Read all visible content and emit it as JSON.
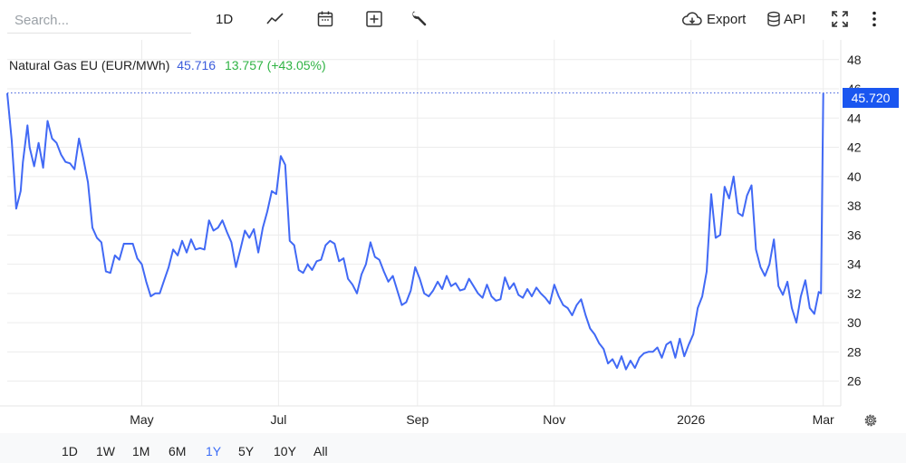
{
  "toolbar": {
    "search_placeholder": "Search...",
    "interval_label": "1D",
    "export_label": "Export",
    "api_label": "API",
    "icons": [
      "line-chart-icon",
      "calendar-icon",
      "add-box-icon",
      "wrench-icon",
      "cloud-download-icon",
      "database-icon",
      "fullscreen-icon",
      "more-vertical-icon"
    ]
  },
  "legend": {
    "name": "Natural Gas EU (EUR/MWh)",
    "value": "45.716",
    "change": "13.757 (+43.05%)"
  },
  "price_tag": "45.720",
  "range_buttons": [
    "1D",
    "1W",
    "1M",
    "6M",
    "1Y",
    "5Y",
    "10Y",
    "All"
  ],
  "active_range": "1Y",
  "colors": {
    "line": "#4169f5",
    "accent": "#1a56f0",
    "positive": "#2fb344",
    "grid": "#ececec"
  },
  "chart_data": {
    "type": "line",
    "title": "Natural Gas EU (EUR/MWh)",
    "xlabel": "",
    "ylabel": "",
    "x_tick_labels": [
      "May",
      "Jul",
      "Sep",
      "Nov",
      "2026",
      "Mar"
    ],
    "x_ticks": [
      "2025-05-01",
      "2025-07-01",
      "2025-09-01",
      "2025-11-01",
      "2026-01-01",
      "2026-03-01"
    ],
    "xlim": [
      "2025-03-02",
      "2026-03-08"
    ],
    "y_ticks": [
      26,
      28,
      30,
      32,
      34,
      36,
      38,
      40,
      42,
      44,
      46,
      48
    ],
    "ylim": [
      24.3,
      49.6
    ],
    "last_price_line": 45.72,
    "grid": true,
    "series": [
      {
        "points": [
          [
            "2025-03-02",
            45.7
          ],
          [
            "2025-03-04",
            42.5
          ],
          [
            "2025-03-05",
            40.2
          ],
          [
            "2025-03-06",
            37.8
          ],
          [
            "2025-03-08",
            39.0
          ],
          [
            "2025-03-09",
            41.0
          ],
          [
            "2025-03-11",
            43.5
          ],
          [
            "2025-03-12",
            42.0
          ],
          [
            "2025-03-14",
            40.7
          ],
          [
            "2025-03-16",
            42.3
          ],
          [
            "2025-03-18",
            40.6
          ],
          [
            "2025-03-20",
            43.8
          ],
          [
            "2025-03-22",
            42.6
          ],
          [
            "2025-03-24",
            42.3
          ],
          [
            "2025-03-26",
            41.5
          ],
          [
            "2025-03-28",
            41.0
          ],
          [
            "2025-03-30",
            40.9
          ],
          [
            "2025-04-01",
            40.5
          ],
          [
            "2025-04-03",
            42.6
          ],
          [
            "2025-04-05",
            41.2
          ],
          [
            "2025-04-07",
            39.6
          ],
          [
            "2025-04-09",
            36.5
          ],
          [
            "2025-04-11",
            35.8
          ],
          [
            "2025-04-13",
            35.5
          ],
          [
            "2025-04-15",
            33.5
          ],
          [
            "2025-04-17",
            33.4
          ],
          [
            "2025-04-19",
            34.6
          ],
          [
            "2025-04-21",
            34.3
          ],
          [
            "2025-04-23",
            35.4
          ],
          [
            "2025-04-25",
            35.4
          ],
          [
            "2025-04-27",
            35.4
          ],
          [
            "2025-04-29",
            34.4
          ],
          [
            "2025-05-01",
            34.0
          ],
          [
            "2025-05-03",
            32.8
          ],
          [
            "2025-05-05",
            31.8
          ],
          [
            "2025-05-07",
            32.0
          ],
          [
            "2025-05-09",
            32.0
          ],
          [
            "2025-05-11",
            32.9
          ],
          [
            "2025-05-13",
            33.8
          ],
          [
            "2025-05-15",
            35.0
          ],
          [
            "2025-05-17",
            34.6
          ],
          [
            "2025-05-19",
            35.6
          ],
          [
            "2025-05-21",
            34.8
          ],
          [
            "2025-05-23",
            35.7
          ],
          [
            "2025-05-25",
            35.0
          ],
          [
            "2025-05-27",
            35.1
          ],
          [
            "2025-05-29",
            35.0
          ],
          [
            "2025-05-31",
            37.0
          ],
          [
            "2025-06-02",
            36.3
          ],
          [
            "2025-06-04",
            36.5
          ],
          [
            "2025-06-06",
            37.0
          ],
          [
            "2025-06-08",
            36.2
          ],
          [
            "2025-06-10",
            35.5
          ],
          [
            "2025-06-12",
            33.8
          ],
          [
            "2025-06-14",
            35.0
          ],
          [
            "2025-06-16",
            36.3
          ],
          [
            "2025-06-18",
            35.8
          ],
          [
            "2025-06-20",
            36.4
          ],
          [
            "2025-06-22",
            34.8
          ],
          [
            "2025-06-24",
            36.5
          ],
          [
            "2025-06-26",
            37.6
          ],
          [
            "2025-06-28",
            39.0
          ],
          [
            "2025-06-30",
            38.8
          ],
          [
            "2025-07-02",
            41.4
          ],
          [
            "2025-07-04",
            40.8
          ],
          [
            "2025-07-06",
            35.6
          ],
          [
            "2025-07-08",
            35.3
          ],
          [
            "2025-07-10",
            33.6
          ],
          [
            "2025-07-12",
            33.4
          ],
          [
            "2025-07-14",
            34.0
          ],
          [
            "2025-07-16",
            33.6
          ],
          [
            "2025-07-18",
            34.2
          ],
          [
            "2025-07-20",
            34.3
          ],
          [
            "2025-07-22",
            35.3
          ],
          [
            "2025-07-24",
            35.6
          ],
          [
            "2025-07-26",
            35.4
          ],
          [
            "2025-07-28",
            34.2
          ],
          [
            "2025-07-30",
            34.4
          ],
          [
            "2025-08-01",
            33.0
          ],
          [
            "2025-08-03",
            32.6
          ],
          [
            "2025-08-05",
            32.0
          ],
          [
            "2025-08-07",
            33.3
          ],
          [
            "2025-08-09",
            34.0
          ],
          [
            "2025-08-11",
            35.5
          ],
          [
            "2025-08-13",
            34.5
          ],
          [
            "2025-08-15",
            34.3
          ],
          [
            "2025-08-17",
            33.5
          ],
          [
            "2025-08-19",
            32.8
          ],
          [
            "2025-08-21",
            33.2
          ],
          [
            "2025-08-23",
            32.2
          ],
          [
            "2025-08-25",
            31.2
          ],
          [
            "2025-08-27",
            31.4
          ],
          [
            "2025-08-29",
            32.2
          ],
          [
            "2025-08-31",
            33.8
          ],
          [
            "2025-09-02",
            33.0
          ],
          [
            "2025-09-04",
            32.0
          ],
          [
            "2025-09-06",
            31.8
          ],
          [
            "2025-09-08",
            32.2
          ],
          [
            "2025-09-10",
            32.8
          ],
          [
            "2025-09-12",
            32.3
          ],
          [
            "2025-09-14",
            33.2
          ],
          [
            "2025-09-16",
            32.5
          ],
          [
            "2025-09-18",
            32.7
          ],
          [
            "2025-09-20",
            32.2
          ],
          [
            "2025-09-22",
            32.3
          ],
          [
            "2025-09-24",
            33.0
          ],
          [
            "2025-09-26",
            32.5
          ],
          [
            "2025-09-28",
            32.0
          ],
          [
            "2025-09-30",
            31.7
          ],
          [
            "2025-10-02",
            32.6
          ],
          [
            "2025-10-04",
            31.8
          ],
          [
            "2025-10-06",
            31.5
          ],
          [
            "2025-10-08",
            31.6
          ],
          [
            "2025-10-10",
            33.1
          ],
          [
            "2025-10-12",
            32.3
          ],
          [
            "2025-10-14",
            32.7
          ],
          [
            "2025-10-16",
            31.9
          ],
          [
            "2025-10-18",
            31.7
          ],
          [
            "2025-10-20",
            32.3
          ],
          [
            "2025-10-22",
            31.8
          ],
          [
            "2025-10-24",
            32.4
          ],
          [
            "2025-10-26",
            32.0
          ],
          [
            "2025-10-28",
            31.7
          ],
          [
            "2025-10-30",
            31.3
          ],
          [
            "2025-11-01",
            32.6
          ],
          [
            "2025-11-03",
            31.8
          ],
          [
            "2025-11-05",
            31.2
          ],
          [
            "2025-11-07",
            31.0
          ],
          [
            "2025-11-09",
            30.5
          ],
          [
            "2025-11-11",
            31.2
          ],
          [
            "2025-11-13",
            31.6
          ],
          [
            "2025-11-15",
            30.5
          ],
          [
            "2025-11-17",
            29.6
          ],
          [
            "2025-11-19",
            29.2
          ],
          [
            "2025-11-21",
            28.6
          ],
          [
            "2025-11-23",
            28.2
          ],
          [
            "2025-11-25",
            27.2
          ],
          [
            "2025-11-27",
            27.5
          ],
          [
            "2025-11-29",
            26.9
          ],
          [
            "2025-12-01",
            27.7
          ],
          [
            "2025-12-03",
            26.8
          ],
          [
            "2025-12-05",
            27.4
          ],
          [
            "2025-12-07",
            26.9
          ],
          [
            "2025-12-09",
            27.6
          ],
          [
            "2025-12-11",
            27.9
          ],
          [
            "2025-12-13",
            28.0
          ],
          [
            "2025-12-15",
            28.0
          ],
          [
            "2025-12-17",
            28.3
          ],
          [
            "2025-12-19",
            27.6
          ],
          [
            "2025-12-21",
            28.5
          ],
          [
            "2025-12-23",
            28.7
          ],
          [
            "2025-12-25",
            27.6
          ],
          [
            "2025-12-27",
            28.9
          ],
          [
            "2025-12-29",
            27.7
          ],
          [
            "2025-12-31",
            28.5
          ],
          [
            "2026-01-02",
            29.2
          ],
          [
            "2026-01-04",
            31.0
          ],
          [
            "2026-01-06",
            31.8
          ],
          [
            "2026-01-08",
            33.5
          ],
          [
            "2026-01-10",
            38.8
          ],
          [
            "2026-01-12",
            35.8
          ],
          [
            "2026-01-14",
            36.0
          ],
          [
            "2026-01-16",
            39.3
          ],
          [
            "2026-01-18",
            38.5
          ],
          [
            "2026-01-20",
            40.0
          ],
          [
            "2026-01-22",
            37.5
          ],
          [
            "2026-01-24",
            37.3
          ],
          [
            "2026-01-26",
            38.7
          ],
          [
            "2026-01-28",
            39.4
          ],
          [
            "2026-01-30",
            35.0
          ],
          [
            "2026-02-01",
            33.8
          ],
          [
            "2026-02-03",
            33.2
          ],
          [
            "2026-02-05",
            34.0
          ],
          [
            "2026-02-07",
            35.7
          ],
          [
            "2026-02-09",
            32.5
          ],
          [
            "2026-02-11",
            31.9
          ],
          [
            "2026-02-13",
            32.8
          ],
          [
            "2026-02-15",
            31.0
          ],
          [
            "2026-02-17",
            30.0
          ],
          [
            "2026-02-19",
            31.8
          ],
          [
            "2026-02-21",
            32.9
          ],
          [
            "2026-02-23",
            31.0
          ],
          [
            "2026-02-25",
            30.6
          ],
          [
            "2026-02-27",
            32.1
          ],
          [
            "2026-02-28",
            32.0
          ],
          [
            "2026-03-01",
            45.7
          ]
        ]
      }
    ]
  }
}
